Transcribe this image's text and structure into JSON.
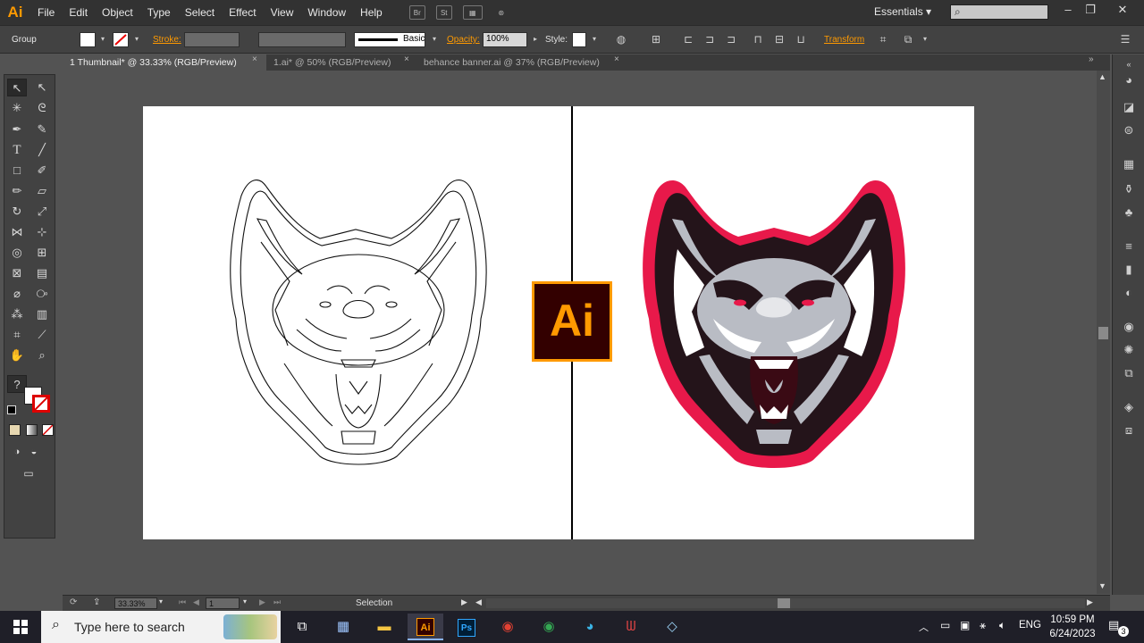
{
  "app": {
    "logo": "Ai"
  },
  "menu": [
    "File",
    "Edit",
    "Object",
    "Type",
    "Select",
    "Effect",
    "View",
    "Window",
    "Help"
  ],
  "menubar_icons": {
    "br": "Br",
    "st": "St"
  },
  "workspace": "Essentials",
  "control": {
    "selection_type": "Group",
    "stroke_label": "Stroke:",
    "brush_label": "Basic",
    "opacity_label": "Opacity:",
    "opacity_value": "100%",
    "style_label": "Style:",
    "transform_label": "Transform"
  },
  "tabs": [
    {
      "label": "1 Thumbnail* @ 33.33% (RGB/Preview)",
      "close": "×"
    },
    {
      "label": "1.ai* @ 50% (RGB/Preview)",
      "close": "×"
    },
    {
      "label": "behance banner.ai @ 37% (RGB/Preview)",
      "close": "×"
    }
  ],
  "artboard": {
    "badge": "Ai"
  },
  "status": {
    "zoom": "33.33%",
    "artboard_num": "1",
    "tool": "Selection"
  },
  "taskbar": {
    "search_placeholder": "Type here to search",
    "lang": "ENG",
    "time": "10:59 PM",
    "date": "6/24/2023",
    "notifications": "3"
  },
  "colors": {
    "accent_orange": "#ff9a00",
    "wolf_red": "#e8194a",
    "wolf_dark": "#2a1418",
    "wolf_gray": "#b9bcc4"
  }
}
